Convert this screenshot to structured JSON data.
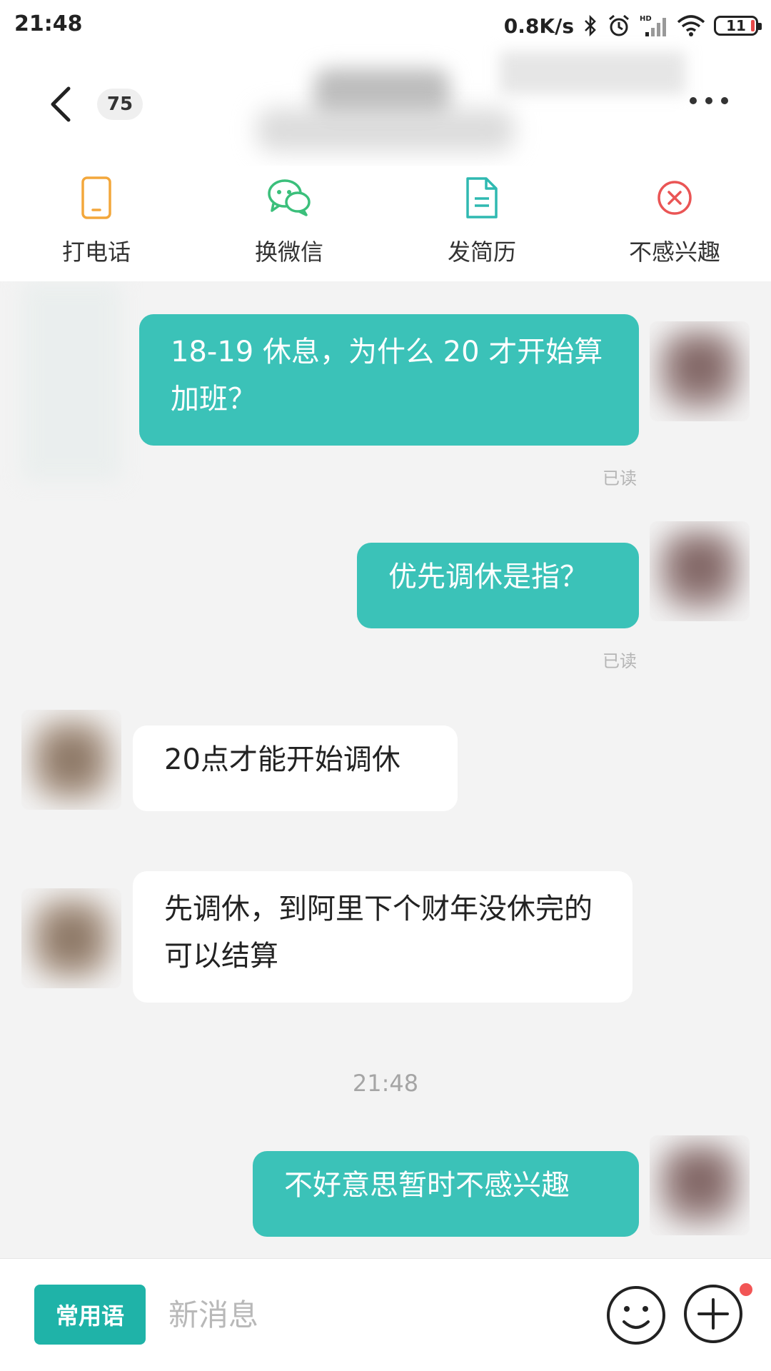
{
  "status_bar": {
    "time": "21:48",
    "net_speed": "0.8K/s",
    "battery": "11",
    "icons": [
      "bluetooth-icon",
      "alarm-icon",
      "hd-signal-icon",
      "wifi-icon",
      "battery-icon"
    ]
  },
  "header": {
    "unread_count": "75",
    "icons": {
      "back": "chevron-left-icon",
      "more": "more-dots-icon"
    }
  },
  "actions": [
    {
      "label": "打电话",
      "icon": "phone-icon",
      "color": "#f3a73b"
    },
    {
      "label": "换微信",
      "icon": "wechat-icon",
      "color": "#3bbf7b"
    },
    {
      "label": "发简历",
      "icon": "resume-doc-icon",
      "color": "#2fb9b1"
    },
    {
      "label": "不感兴趣",
      "icon": "not-interested-icon",
      "color": "#ea5555"
    }
  ],
  "messages": [
    {
      "from": "me",
      "text": "18-19 休息，为什么 20 才开始算加班？",
      "status": "已读"
    },
    {
      "from": "me",
      "text": "优先调休是指？",
      "status": "已读"
    },
    {
      "from": "other",
      "text": "20点才能开始调休"
    },
    {
      "from": "other",
      "text": "先调休，到阿里下个财年没休完的可以结算"
    },
    {
      "type": "time",
      "text": "21:48"
    },
    {
      "from": "me",
      "text": "不好意思暂时不感兴趣"
    }
  ],
  "input_bar": {
    "quick_phrases_label": "常用语",
    "placeholder": "新消息",
    "icons": {
      "emoji": "smile-icon",
      "plus": "plus-icon"
    },
    "has_notification_dot": true
  },
  "colors": {
    "accent": "#3bc2b8",
    "quick_button": "#1fb3a8",
    "chat_background": "#f3f3f3"
  }
}
